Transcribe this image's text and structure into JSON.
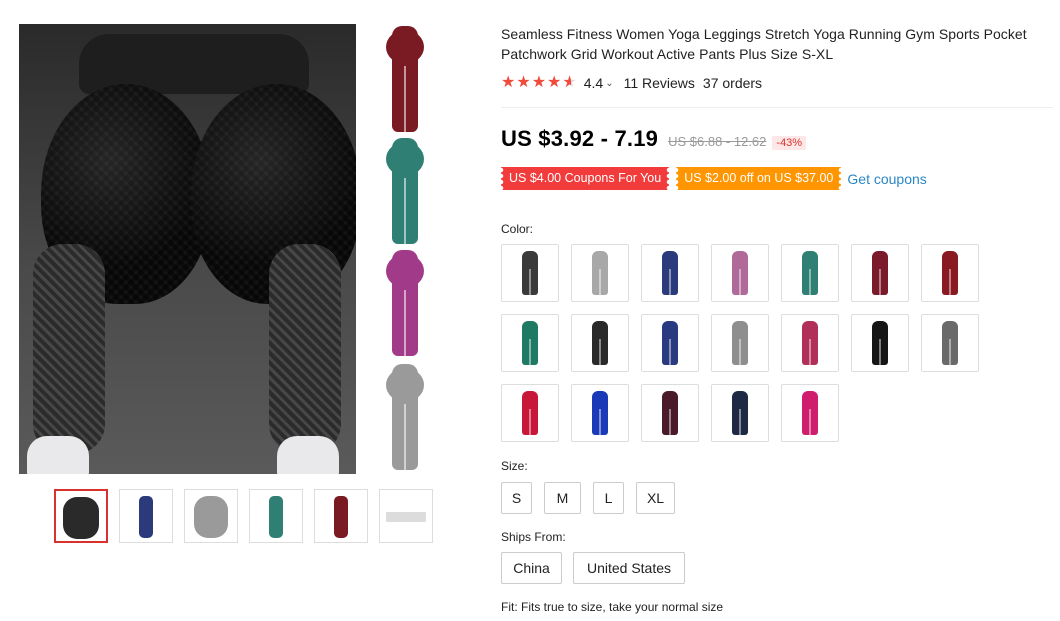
{
  "product": {
    "title": "Seamless Fitness Women Yoga Leggings Stretch Yoga Running Gym Sports Pocket Patchwork Grid Workout Active Pants Plus Size S-XL",
    "rating": {
      "stars": 4.5,
      "value": "4.4",
      "reviews": "11 Reviews",
      "orders": "37 orders"
    },
    "price": {
      "current": "US $3.92 - 7.19",
      "original": "US $6.88 - 12.62",
      "discount": "-43%"
    },
    "coupons": [
      {
        "label": "US $4.00 Coupons For You",
        "color": "#f23b3b"
      },
      {
        "label": "US $2.00 off on US $37.00",
        "color": "#ff9500"
      }
    ],
    "get_coupons_label": "Get coupons"
  },
  "colors": {
    "label": "Color:",
    "swatches": [
      {
        "color": "#3a3a3a"
      },
      {
        "color": "#a8a8a8"
      },
      {
        "color": "#2a3a7a"
      },
      {
        "color": "#b06a9a"
      },
      {
        "color": "#2f7f74"
      },
      {
        "color": "#7a1a2a"
      },
      {
        "color": "#8a1a22"
      },
      {
        "color": "#1f7a64"
      },
      {
        "color": "#2a2a2a"
      },
      {
        "color": "#2a3a80"
      },
      {
        "color": "#8e8e8e"
      },
      {
        "color": "#b0305a"
      },
      {
        "color": "#161616"
      },
      {
        "color": "#6a6a6a"
      },
      {
        "color": "#c8183a"
      },
      {
        "color": "#1a3ab8"
      },
      {
        "color": "#4a1a2a"
      },
      {
        "color": "#1e2a44"
      },
      {
        "color": "#d01e6e"
      }
    ]
  },
  "sizes": {
    "label": "Size:",
    "options": [
      "S",
      "M",
      "L",
      "XL"
    ]
  },
  "ships_from": {
    "label": "Ships From:",
    "options": [
      "China",
      "United States"
    ]
  },
  "fit_note": "Fit: Fits true to size, take your normal size",
  "gallery": {
    "strip_colors": [
      "#7a1a22",
      "#2f7f74",
      "#a23a8a",
      "#9a9a9a"
    ],
    "thumb_colors": [
      "#2a2a2a",
      "#2a3a7a",
      "#9a9a9a",
      "#2f7f74",
      "#7a1a22",
      "#dcdcdc"
    ]
  }
}
